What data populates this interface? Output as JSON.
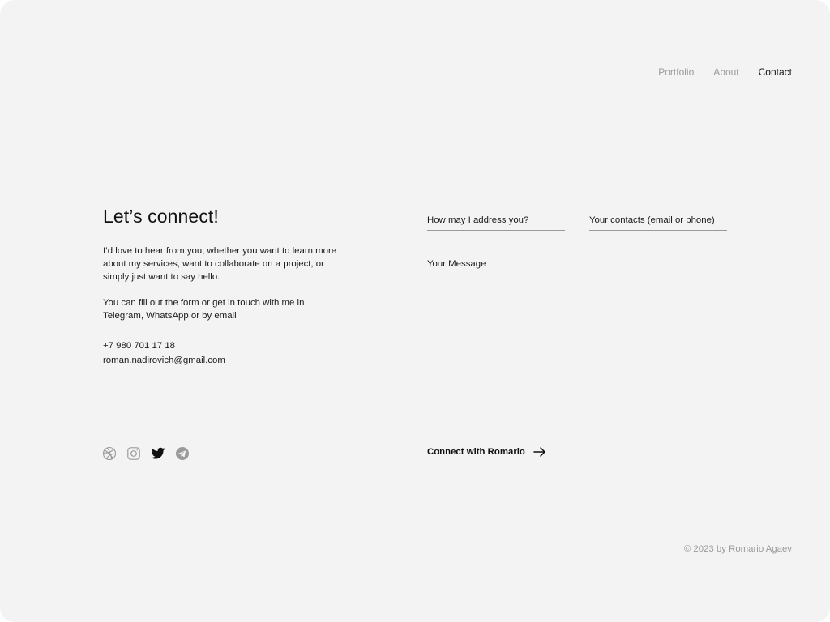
{
  "nav": {
    "items": [
      {
        "label": "Portfolio",
        "active": false
      },
      {
        "label": "About",
        "active": false
      },
      {
        "label": "Contact",
        "active": true
      }
    ]
  },
  "intro": {
    "heading": "Let’s connect!",
    "paragraph1": "I’d love to hear from you; whether you want to learn more about my services, want to collaborate on a project, or simply just want to say hello.",
    "paragraph2": "You can fill out the form or get in touch with me in Telegram, WhatsApp or by email",
    "phone": "+7 980 701 17 18",
    "email": "roman.nadirovich@gmail.com"
  },
  "socials": [
    {
      "name": "dribbble-icon",
      "color": "#9a9a9a"
    },
    {
      "name": "instagram-icon",
      "color": "#9a9a9a"
    },
    {
      "name": "twitter-icon",
      "color": "#111111"
    },
    {
      "name": "telegram-icon",
      "color": "#9a9a9a"
    }
  ],
  "form": {
    "name_placeholder": "How may I address you?",
    "name_value": "",
    "contacts_placeholder": "Your contacts (email or phone)",
    "contacts_value": "",
    "message_placeholder": "Your Message",
    "message_value": "",
    "submit_label": "Connect with Romario",
    "submit_icon": "arrow-right-icon"
  },
  "footer": {
    "copyright": "© 2023 by Romario Agaev"
  },
  "colors": {
    "background": "#f3f3f3",
    "text": "#111111",
    "muted": "#9a9a9a"
  }
}
